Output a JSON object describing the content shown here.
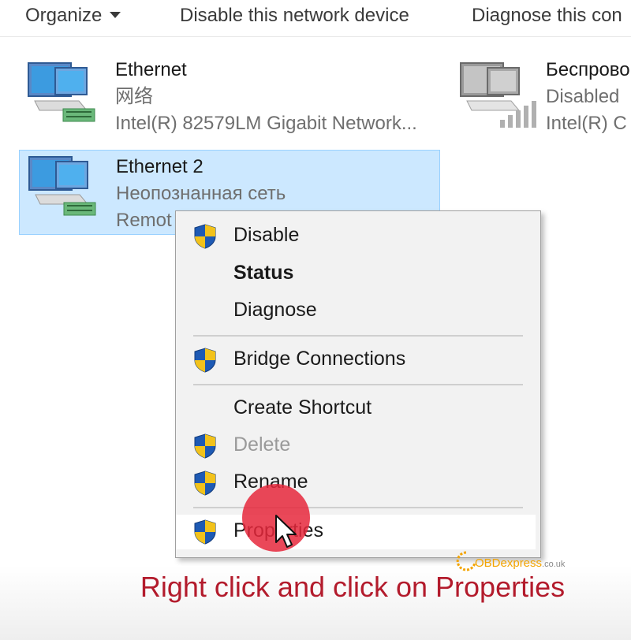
{
  "toolbar": {
    "organize": "Organize",
    "disable_device": "Disable this network device",
    "diagnose": "Diagnose this con"
  },
  "items": [
    {
      "name": "Ethernet",
      "status": "网络",
      "device": "Intel(R) 82579LM Gigabit Network..."
    },
    {
      "name": "Ethernet 2",
      "status": "Неопознанная сеть",
      "device": "Remot"
    },
    {
      "name": "Беспрово",
      "status": "Disabled",
      "device": "Intel(R) C"
    }
  ],
  "menu": {
    "disable": "Disable",
    "status": "Status",
    "diagnose": "Diagnose",
    "bridge": "Bridge Connections",
    "create_shortcut": "Create Shortcut",
    "delete": "Delete",
    "rename": "Rename",
    "properties": "Properties"
  },
  "caption": "Right click and click on Properties",
  "logo": {
    "brand": "OBDexpress",
    "tld": ".co.uk"
  },
  "colors": {
    "selection": "#cce8ff",
    "caption": "#b31b2c",
    "menu_bg": "#f2f2f2"
  }
}
